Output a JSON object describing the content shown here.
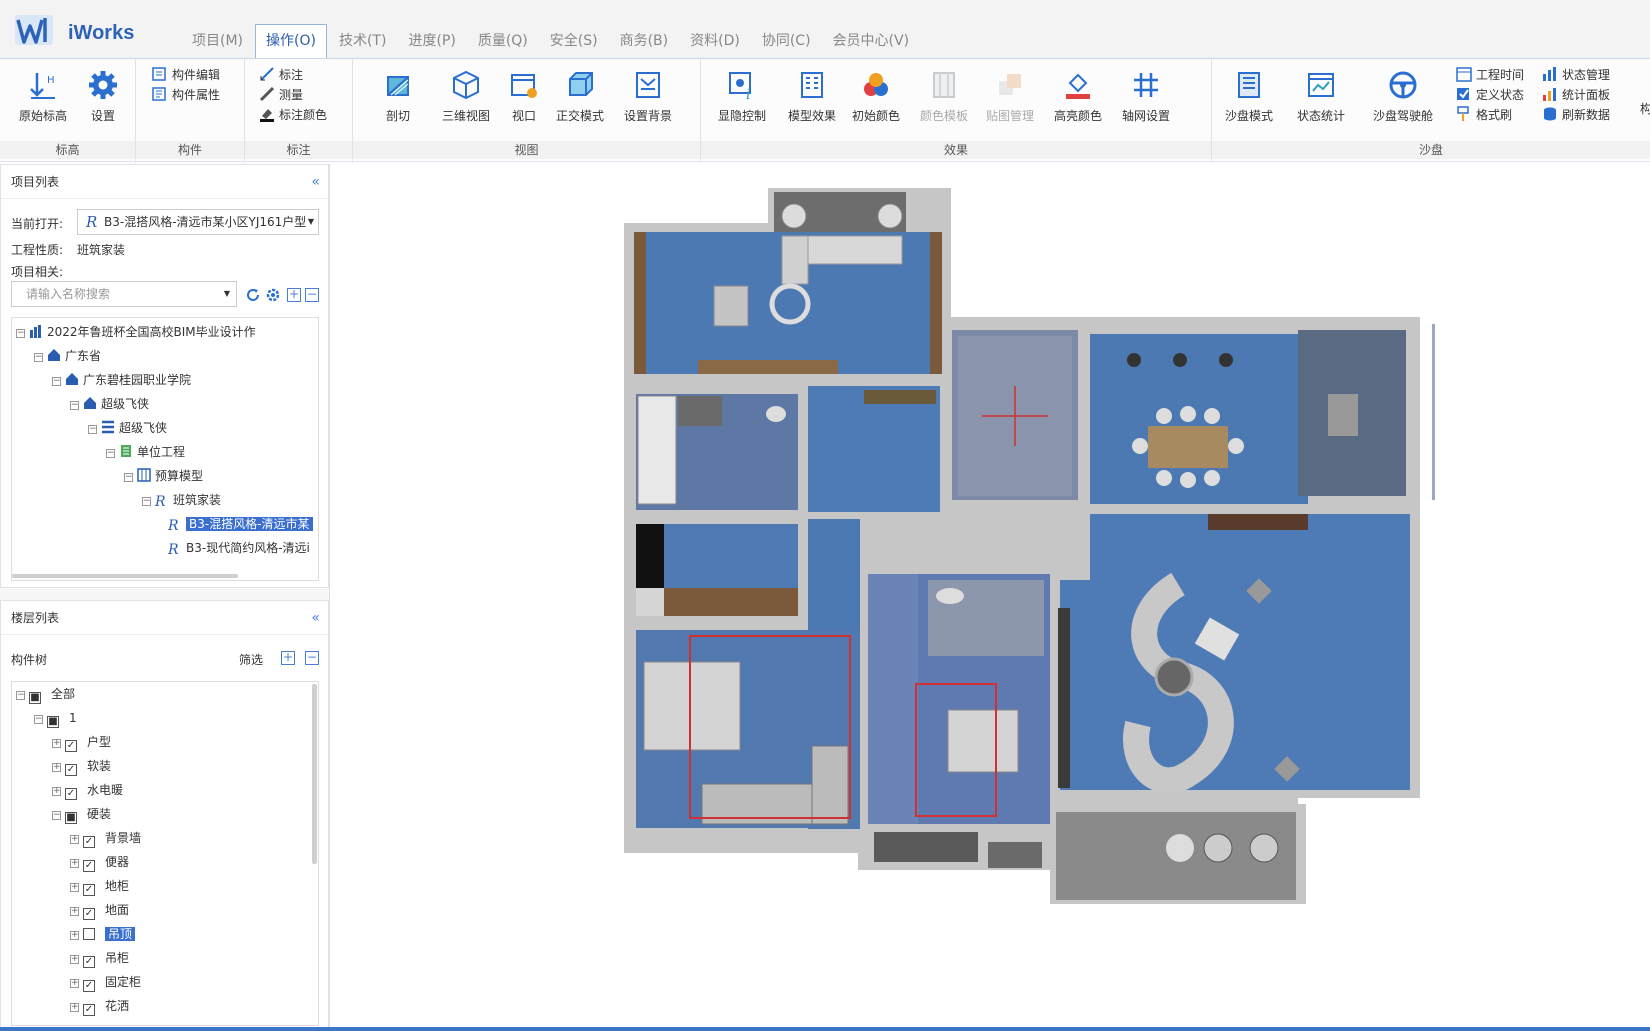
{
  "app": {
    "name": "iWorks"
  },
  "menu": {
    "tabs": [
      "项目(M)",
      "操作(O)",
      "技术(T)",
      "进度(P)",
      "质量(Q)",
      "安全(S)",
      "商务(B)",
      "资料(D)",
      "协同(C)",
      "会员中心(V)"
    ],
    "active": "操作(O)"
  },
  "ribbon": {
    "groups": {
      "elevation": "标高",
      "component": "构件",
      "annotate": "标注",
      "view": "视图",
      "effect": "效果",
      "sandbox": "沙盘"
    },
    "buttons": {
      "origin_elevation": "原始标高",
      "settings": "设置",
      "component_edit": "构件编辑",
      "component_props": "构件属性",
      "annotate": "标注",
      "measure": "测量",
      "annotate_color": "标注颜色",
      "section": "剖切",
      "view3d": "三维视图",
      "viewport": "视口",
      "ortho": "正交模式",
      "set_bg": "设置背景",
      "visibility": "显隐控制",
      "model_effect": "模型效果",
      "init_color": "初始颜色",
      "color_template": "颜色模板",
      "texture_manage": "贴图管理",
      "highlight_color": "高亮颜色",
      "axis_settings": "轴网设置",
      "sandbox_mode": "沙盘模式",
      "status_stats": "状态统计",
      "sandbox_cockpit": "沙盘驾驶舱",
      "project_time": "工程时间",
      "define_status": "定义状态",
      "format_brush": "格式刷",
      "status_manage": "状态管理",
      "stats_panel": "统计面板",
      "refresh_data": "刷新数据",
      "overflow": "构"
    }
  },
  "project_panel": {
    "title": "项目列表",
    "collapse": "«",
    "current_open_label": "当前打开:",
    "current_open_value": "B3-混搭风格-清远市某小区YJ161户型",
    "project_type_label": "工程性质:",
    "project_type_value": "班筑家装",
    "related_label": "项目相关:",
    "search_placeholder": "请输入名称搜索",
    "tree": [
      "2022年鲁班杯全国高校BIM毕业设计作",
      "广东省",
      "广东碧桂园职业学院",
      "超级飞侠",
      "超级飞侠",
      "单位工程",
      "预算模型",
      "班筑家装",
      "B3-混搭风格-清远市某",
      "B3-现代简约风格-清远i"
    ]
  },
  "floor_panel": {
    "title": "楼层列表",
    "collapse": "«",
    "tree_label": "构件树",
    "filter": "筛选",
    "tree": [
      {
        "label": "全部",
        "state": "partial"
      },
      {
        "label": "1",
        "state": "partial"
      },
      {
        "label": "户型",
        "state": "checked"
      },
      {
        "label": "软装",
        "state": "checked"
      },
      {
        "label": "水电暖",
        "state": "checked"
      },
      {
        "label": "硬装",
        "state": "partial"
      },
      {
        "label": "背景墙",
        "state": "checked"
      },
      {
        "label": "便器",
        "state": "checked"
      },
      {
        "label": "地柜",
        "state": "checked"
      },
      {
        "label": "地面",
        "state": "checked"
      },
      {
        "label": "吊顶",
        "state": "unchecked"
      },
      {
        "label": "吊柜",
        "state": "checked"
      },
      {
        "label": "固定柜",
        "state": "checked"
      },
      {
        "label": "花洒",
        "state": "checked"
      }
    ]
  },
  "colors": {
    "accent": "#2a5db0",
    "floor_blue": "#4d79b3",
    "wall_gray": "#c4c4c4",
    "selection": "#3a6fd0"
  }
}
